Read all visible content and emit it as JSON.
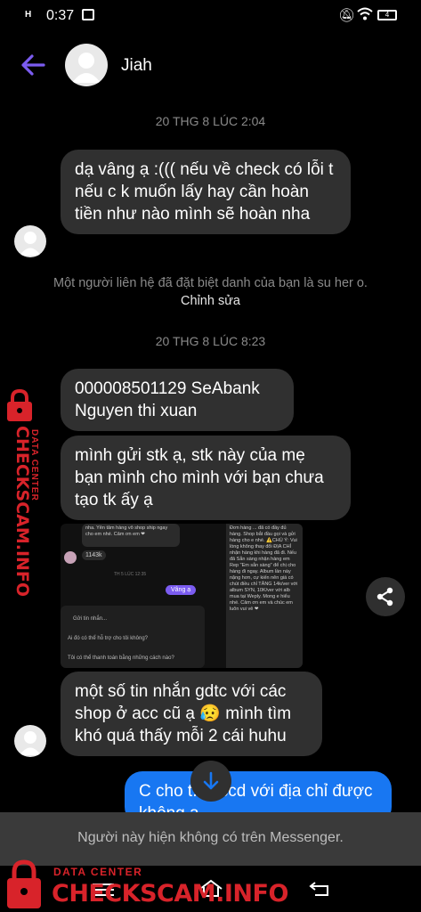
{
  "status_bar": {
    "signal": "H",
    "time": "0:37",
    "battery": "4"
  },
  "header": {
    "contact_name": "Jiah"
  },
  "timestamps": {
    "first": "20 THG 8 LÚC 2:04",
    "second": "20 THG 8 LÚC 8:23"
  },
  "messages": {
    "m1": "dạ vâng ạ :((( nếu về check có lỗi t nếu c k muốn lấy hay cần hoàn tiền như nào mình sẽ hoàn nha",
    "m2": "000008501129 SeAbank Nguyen thi xuan",
    "m3": "mình gửi stk ạ, stk này của mẹ bạn mình cho mình với bạn chưa tạo tk ấy ạ",
    "m4": "một số tin nhắn gdtc với các shop ở acc cũ ạ 😥 mình tìm khó quá thấy mỗi 2 cái huhu",
    "m5": "C cho t... cccd với địa chỉ được không ạ"
  },
  "system_note": {
    "text": "Một người liên hệ đã đặt biệt danh của bạn là su her o.",
    "action": "Chỉnh sửa"
  },
  "image_message": {
    "top_bubble": "nha. Yên tâm hàng vô shop ship ngay cho em nhé. Cảm ơn em ❤",
    "price": "1143k",
    "time": "TH 5 LÚC 12:35",
    "reply": "Vâng ạ",
    "input_placeholder": "Gửi tin nhắn...",
    "question1": "Ai đó có thể hỗ trợ cho tôi không?",
    "question2": "Tôi có thể thanh toán bằng những cách nào?",
    "right_text": "Đơn hàng ... đã có đầy đủ hàng. Shop bắt đầu gọi và gửi hàng cho e nhé. ⚠️CHÚ Ý: Vui lòng không thay đổi ĐỊA CHỈ nhận hàng khi hàng đã đi. Nếu đã Sẵn sàng nhận hàng em Rep \"Em sẵn sàng\" để chị cho hàng đi ngay. Album lần này nặng hơn, cự kiến nên giá có chút điều chỉ TĂNG 14k/ver với album SYN, 10K/ver với alb mua tại Weply. Mong e hiểu nhé. Cảm ơn em và chúc em luôn vui vẻ ❤"
  },
  "bottom_bar": {
    "unavailable": "Người này hiện không có trên Messenger."
  },
  "watermark": {
    "main": "CHECKSCAM.INFO",
    "sub": "DATA CENTER"
  },
  "colors": {
    "accent": "#7b5cf0",
    "outgoing_bubble": "#1877f2",
    "incoming_bubble": "#303030",
    "watermark": "#d8232a"
  },
  "icons": [
    "back-arrow-icon",
    "share-icon",
    "scroll-down-icon",
    "wifi-icon",
    "mute-icon",
    "battery-icon",
    "gallery-icon"
  ]
}
